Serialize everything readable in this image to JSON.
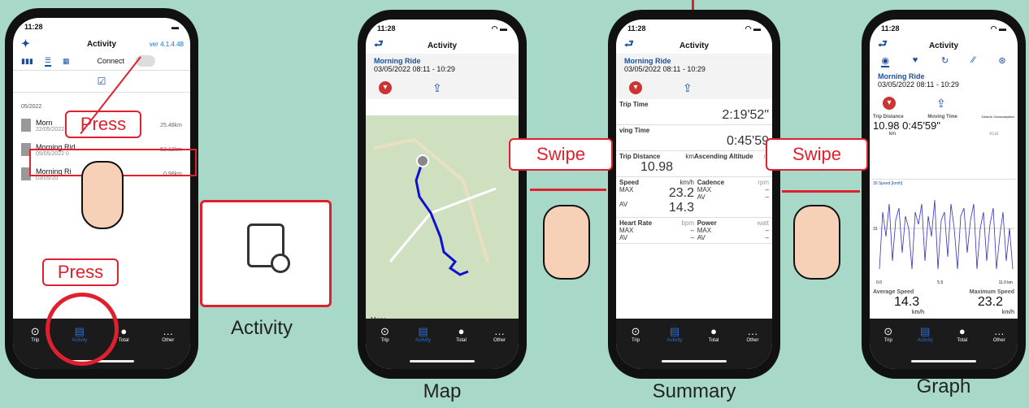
{
  "colors": {
    "background": "#a8d8c8",
    "accent": "#e0202e",
    "link": "#1a4fa0"
  },
  "status_time": "11:28",
  "tabbar": [
    "Trip",
    "Activity",
    "Total",
    "Other"
  ],
  "phone1": {
    "title": "Activity",
    "version": "ver 4.1.4.48",
    "connect": "Connect",
    "month": "05/2022",
    "rides": [
      {
        "name": "Morn",
        "date": "22/05/2022 0",
        "dist": "25.48km"
      },
      {
        "name": "Morning Rid",
        "date": "05/05/2022 0",
        "dist": "52.12km"
      },
      {
        "name": "Morning Ri",
        "date": "03/05/20",
        "dist": "0.98km"
      }
    ]
  },
  "ride": {
    "name": "Morning Ride",
    "date": "03/05/2022 08:11 - 10:29"
  },
  "phone2": {
    "title": "Activity",
    "maps": "Maps"
  },
  "phone3": {
    "title": "Activity",
    "trip_time_label": "Trip Time",
    "trip_time": "2:19'52\"",
    "moving_time_label": "ving Time",
    "moving_time": "0:45'59",
    "trip_distance_label": "Trip Distance",
    "km": "km",
    "trip_distance": "10.98",
    "ascending_label": "Ascending Altitude",
    "m": "m",
    "speed_label": "Speed",
    "kmh": "km/h",
    "speed_max": "23.2",
    "speed_av": "14.3",
    "cadence_label": "Cadence",
    "rpm": "rpm",
    "heart_label": "Heart Rate",
    "bpm": "bpm",
    "power_label": "Power",
    "watt": "watt",
    "max": "MAX",
    "av": "AV",
    "dash": "–"
  },
  "phone4": {
    "title": "Activity",
    "trip_distance_label": "Trip Distance",
    "moving_time_label": "Moving Time",
    "calorie_label": "Calorie Consumption",
    "values": "10.98 0:45'59\"",
    "km": "km",
    "kcal": "kcal",
    "graph_label": "Speed [km/h]",
    "y30": "30",
    "y15": "15",
    "x0": "0.0",
    "x55": "5.5",
    "x11": "11.0 km",
    "avg_label": "Average Speed",
    "avg": "14.3",
    "max_label": "Maximum Speed",
    "max": "23.2",
    "kmh": "km/h"
  },
  "callouts": {
    "press1": "Press",
    "press2": "Press",
    "swipe1": "Swipe",
    "swipe2": "Swipe",
    "activity": "Activity"
  },
  "captions": {
    "map": "Map",
    "summary": "Summary",
    "graph": "Graph"
  }
}
